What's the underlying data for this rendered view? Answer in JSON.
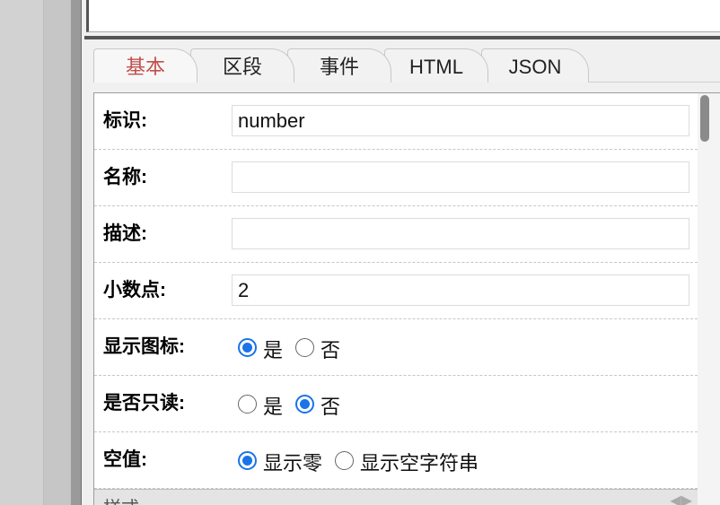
{
  "tabs": [
    {
      "label": "基本",
      "active": true
    },
    {
      "label": "区段",
      "active": false
    },
    {
      "label": "事件",
      "active": false
    },
    {
      "label": "HTML",
      "active": false
    },
    {
      "label": "JSON",
      "active": false
    }
  ],
  "fields": {
    "identifier": {
      "label": "标识:",
      "value": "number"
    },
    "name": {
      "label": "名称:",
      "value": ""
    },
    "description": {
      "label": "描述:",
      "value": ""
    },
    "decimals": {
      "label": "小数点:",
      "value": "2"
    }
  },
  "show_icon": {
    "label": "显示图标:",
    "options": [
      "是",
      "否"
    ],
    "selected": "是"
  },
  "readonly": {
    "label": "是否只读:",
    "options": [
      "是",
      "否"
    ],
    "selected": "否"
  },
  "empty_value": {
    "label": "空值:",
    "options": [
      "显示零",
      "显示空字符串"
    ],
    "selected": "显示零"
  },
  "style_section": {
    "title": "样式"
  },
  "colors": {
    "active_tab": "#c0504d",
    "radio_checked": "#1a73e8"
  }
}
